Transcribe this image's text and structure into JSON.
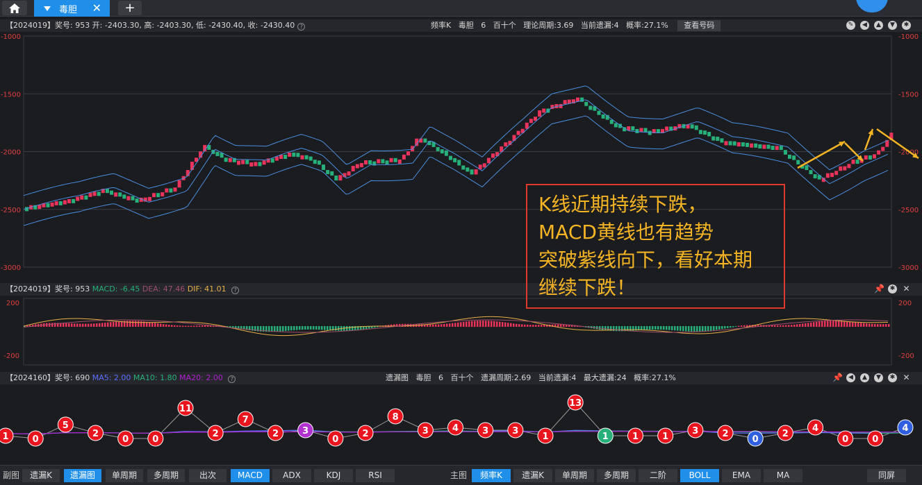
{
  "tabs": {
    "active_label": "毒胆"
  },
  "main_info": {
    "left": "【2024019】奖号: 953  开: -2403.30, 高: -2403.30, 低: -2430.40, 收: -2430.40",
    "center_items": [
      "频率K",
      "毒胆",
      "6",
      "百十个",
      "理论周期:3.69",
      "当前遗漏:4",
      "概率:27.1%"
    ],
    "check_button": "查看号码"
  },
  "main_axis": {
    "labels": [
      "-1000",
      "-1500",
      "-2000",
      "-2500",
      "-3000"
    ],
    "values": [
      -1000,
      -1500,
      -2000,
      -2500,
      -3000
    ]
  },
  "macd_info": {
    "prefix": "【2024019】奖号: 953",
    "macd": "MACD: -6.45",
    "dea": "DEA: 47.46",
    "dif": "DIF: 41.01"
  },
  "macd_axis": {
    "top": "200",
    "bottom": "-200"
  },
  "miss_info": {
    "prefix": "【2024160】奖号: 690",
    "ma5": "MA5: 2.00",
    "ma10": "MA10: 1.80",
    "ma20": "MA20: 2.00",
    "center_items": [
      "遗漏图",
      "毒胆",
      "6",
      "百十个",
      "遗漏周期:2.69",
      "当前遗漏:4",
      "最大遗漏:24",
      "概率:27.1%"
    ]
  },
  "miss_values": [
    1,
    0,
    5,
    2,
    0,
    0,
    11,
    2,
    7,
    2,
    3,
    0,
    2,
    8,
    3,
    4,
    3,
    3,
    1,
    13,
    1,
    1,
    1,
    3,
    2,
    0,
    2,
    4,
    0,
    0,
    4
  ],
  "callout": {
    "lines": [
      "K线近期持续下跌，",
      "MACD黄线也有趋势",
      "突破紫线向下，看好本期",
      "继续下跌！"
    ]
  },
  "bottom_left": {
    "label": "副图",
    "buttons": [
      "遗漏K",
      "遗漏图",
      "单周期",
      "多周期",
      "出次",
      "MACD",
      "ADX",
      "KDJ",
      "RSI"
    ],
    "active": [
      "遗漏图",
      "MACD"
    ]
  },
  "bottom_right": {
    "label": "主图",
    "buttons": [
      "频率K",
      "遗漏K",
      "单周期",
      "多周期",
      "二阶",
      "BOLL",
      "EMA",
      "MA"
    ],
    "active": [
      "频率K",
      "BOLL"
    ],
    "fullscreen": "同屏"
  },
  "colors": {
    "up": "#e8345a",
    "down": "#27b07a",
    "boll": "#4a8fe0",
    "arrow": "#f5b424",
    "ma5": "#5a6fff",
    "ma10": "#27b07a",
    "ma20": "#b020d0"
  }
}
